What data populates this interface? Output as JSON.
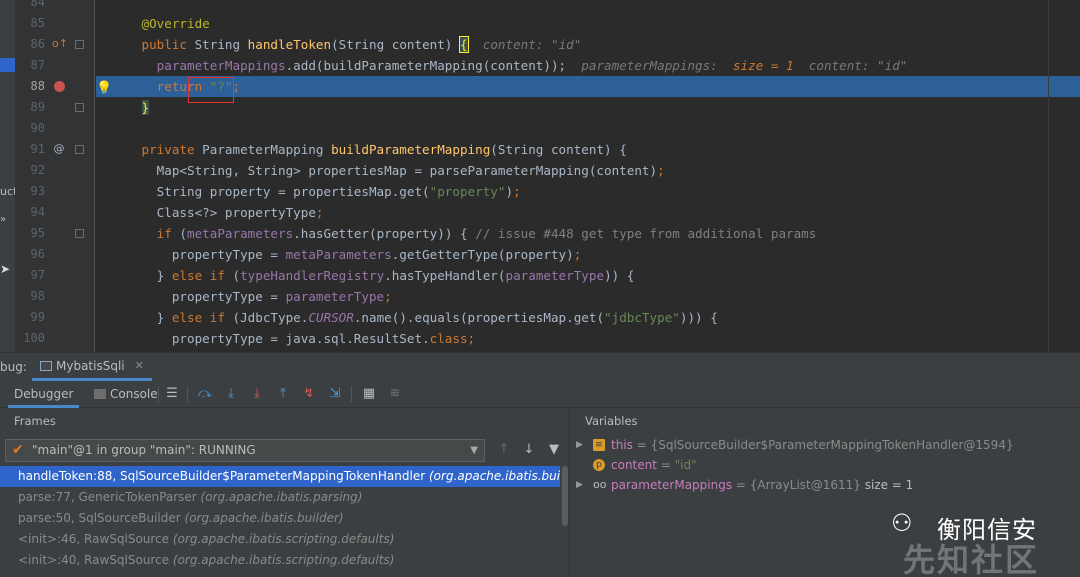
{
  "left_strip": {
    "label_1": "uct",
    "label_2": "»"
  },
  "gutter": {
    "lines": [
      "84",
      "85",
      "86",
      "87",
      "88",
      "89",
      "90",
      "91",
      "92",
      "93",
      "94",
      "95",
      "96",
      "97",
      "98",
      "99",
      "100"
    ]
  },
  "code": {
    "l85": "@Override",
    "l86_kw": "public",
    "l86_type": " String ",
    "l86_fn": "handleToken",
    "l86_params": "(String content) ",
    "l86_brace": "{",
    "l86_hint": "content: \"id\"",
    "l87_fld": "parameterMappings",
    "l87_rest": ".add(buildParameterMapping(content));",
    "l87_hint_a": "parameterMappings:",
    "l87_hint_size": "size = 1",
    "l87_hint_b": "content: \"id\"",
    "l88_kw": "return",
    "l88_str": "\"?\"",
    "l88_end": ";",
    "l89": "}",
    "l91_kw": "private",
    "l91_type": " ParameterMapping ",
    "l91_fn": "buildParameterMapping",
    "l91_rest": "(String content) {",
    "l92_a": "Map<String, String> propertiesMap = parseParameterMapping(content)",
    "l92_b": ";",
    "l93_a": "String property = propertiesMap.get(",
    "l93_str": "\"property\"",
    "l93_b": ")",
    "l93_c": ";",
    "l94_a": "Class<?> propertyType",
    "l94_b": ";",
    "l95_kw": "if",
    "l95_a": " (",
    "l95_fld": "metaParameters",
    "l95_b": ".hasGetter(property)) { ",
    "l95_cmt": "// issue #448 get type from additional params",
    "l96_a": "propertyType = ",
    "l96_fld": "metaParameters",
    "l96_b": ".getGetterType(property)",
    "l96_c": ";",
    "l97_a": "} ",
    "l97_kw": "else if",
    "l97_b": " (",
    "l97_fld": "typeHandlerRegistry",
    "l97_c": ".hasTypeHandler(",
    "l97_fld2": "parameterType",
    "l97_d": ")) {",
    "l98_a": "propertyType = ",
    "l98_fld": "parameterType",
    "l98_b": ";",
    "l99_a": "} ",
    "l99_kw": "else if",
    "l99_b": " (JdbcType.",
    "l99_fld": "CURSOR",
    "l99_c": ".name().equals(propertiesMap.get(",
    "l99_str": "\"jdbcType\"",
    "l99_d": "))) {",
    "l100_a": "propertyType = java.sql.ResultSet.",
    "l100_kw": "class",
    "l100_b": ";"
  },
  "debug": {
    "label": "bug:",
    "session_tab": "MybatisSqli",
    "tab_debugger": "Debugger",
    "tab_console": "Console"
  },
  "frames": {
    "header": "Frames",
    "thread": "\"main\"@1 in group \"main\": RUNNING",
    "items": [
      {
        "method": "handleToken:88, SqlSourceBuilder$ParameterMappingTokenHandler",
        "pkg": "(org.apache.ibatis.builder)"
      },
      {
        "method": "parse:77, GenericTokenParser",
        "pkg": "(org.apache.ibatis.parsing)"
      },
      {
        "method": "parse:50, SqlSourceBuilder",
        "pkg": "(org.apache.ibatis.builder)"
      },
      {
        "method": "<init>:46, RawSqlSource",
        "pkg": "(org.apache.ibatis.scripting.defaults)"
      },
      {
        "method": "<init>:40, RawSqlSource",
        "pkg": "(org.apache.ibatis.scripting.defaults)"
      }
    ]
  },
  "variables": {
    "header": "Variables",
    "items": [
      {
        "name": "this",
        "value": "{SqlSourceBuilder$ParameterMappingTokenHandler@1594}",
        "extra": ""
      },
      {
        "name": "content",
        "value": "\"id\"",
        "extra": ""
      },
      {
        "name": "parameterMappings",
        "value": "{ArrayList@1611}",
        "extra": " size = 1"
      }
    ]
  },
  "watermark": {
    "title": "衡阳信安",
    "sub": "先知社区"
  },
  "colors": {
    "highlight_line": "#2d6099",
    "selected_frame": "#2f65ca",
    "breakpoint": "#c75450",
    "red_box": "#e5332f"
  }
}
